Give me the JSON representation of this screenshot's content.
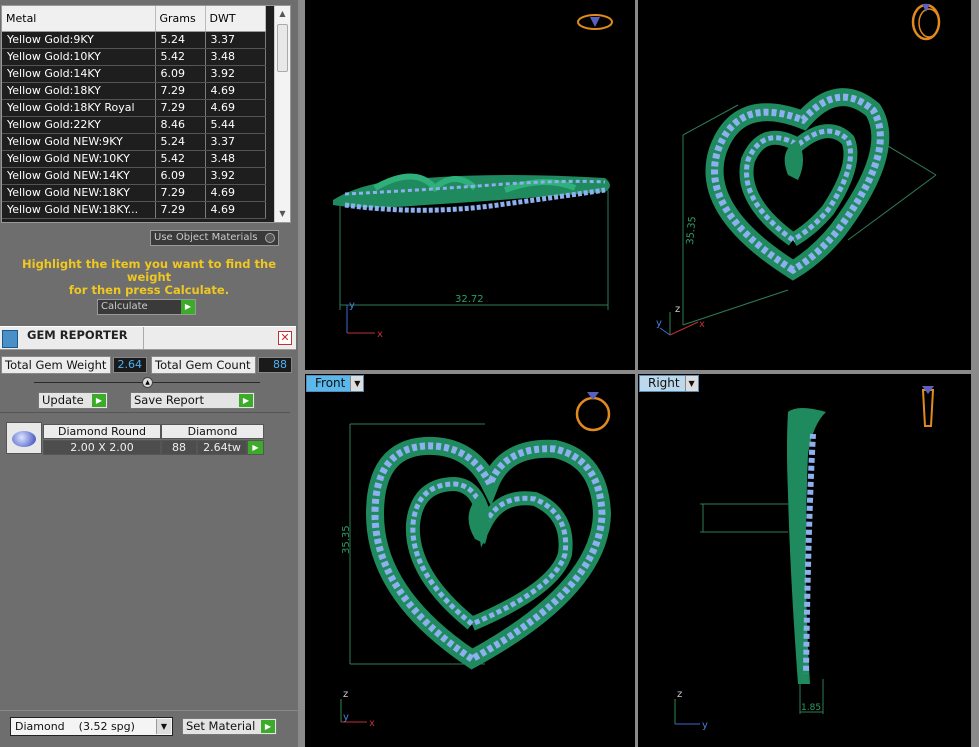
{
  "metal_table": {
    "columns": [
      "Metal",
      "Grams",
      "DWT"
    ],
    "rows": [
      [
        "Yellow Gold:9KY",
        "5.24",
        "3.37"
      ],
      [
        "Yellow Gold:10KY",
        "5.42",
        "3.48"
      ],
      [
        "Yellow Gold:14KY",
        "6.09",
        "3.92"
      ],
      [
        "Yellow Gold:18KY",
        "7.29",
        "4.69"
      ],
      [
        "Yellow Gold:18KY Royal",
        "7.29",
        "4.69"
      ],
      [
        "Yellow Gold:22KY",
        "8.46",
        "5.44"
      ],
      [
        "Yellow Gold NEW:9KY",
        "5.24",
        "3.37"
      ],
      [
        "Yellow Gold NEW:10KY",
        "5.42",
        "3.48"
      ],
      [
        "Yellow Gold NEW:14KY",
        "6.09",
        "3.92"
      ],
      [
        "Yellow Gold NEW:18KY",
        "7.29",
        "4.69"
      ],
      [
        "Yellow Gold NEW:18KY...",
        "7.29",
        "4.69"
      ]
    ]
  },
  "use_object_materials_label": "Use Object Materials",
  "instructions": {
    "line1": "Highlight the item you want to find the weight",
    "line2": "for then press Calculate."
  },
  "calculate_label": "Calculate",
  "gem_reporter": {
    "title": "GEM REPORTER",
    "close_icon": "close-icon",
    "total_gem_weight_label": "Total Gem Weight",
    "total_gem_weight_value": "2.64",
    "total_gem_count_label": "Total Gem Count",
    "total_gem_count_value": "88",
    "update_label": "Update",
    "save_report_label": "Save Report",
    "gem_item": {
      "shape": "Diamond Round",
      "material": "Diamond",
      "size": "2.00 X 2.00",
      "count": "88",
      "weight": "2.64tw"
    }
  },
  "material_select": {
    "value": "Diamond",
    "spg": "(3.52 spg)"
  },
  "set_material_label": "Set Material",
  "viewports": {
    "top_left": {
      "dimension": "32.72",
      "axis_y": "y",
      "axis_x": "x"
    },
    "top_right": {
      "dimension": "35.35",
      "axis_y": "y",
      "axis_z": "z",
      "axis_x": "x"
    },
    "bottom_left": {
      "label": "Front",
      "dimension": "35.35",
      "axis_z": "z",
      "axis_y": "y",
      "axis_x": "x"
    },
    "bottom_right": {
      "label": "Right",
      "dimension": "1.85",
      "axis_z": "z",
      "axis_y": "y"
    }
  },
  "colors": {
    "model_green": "#1f8a5e",
    "gem_blue": "#8fb0f0",
    "instruction_yellow": "#f0c820",
    "play_green": "#3cab2a",
    "value_blue": "#4fb0f0"
  }
}
